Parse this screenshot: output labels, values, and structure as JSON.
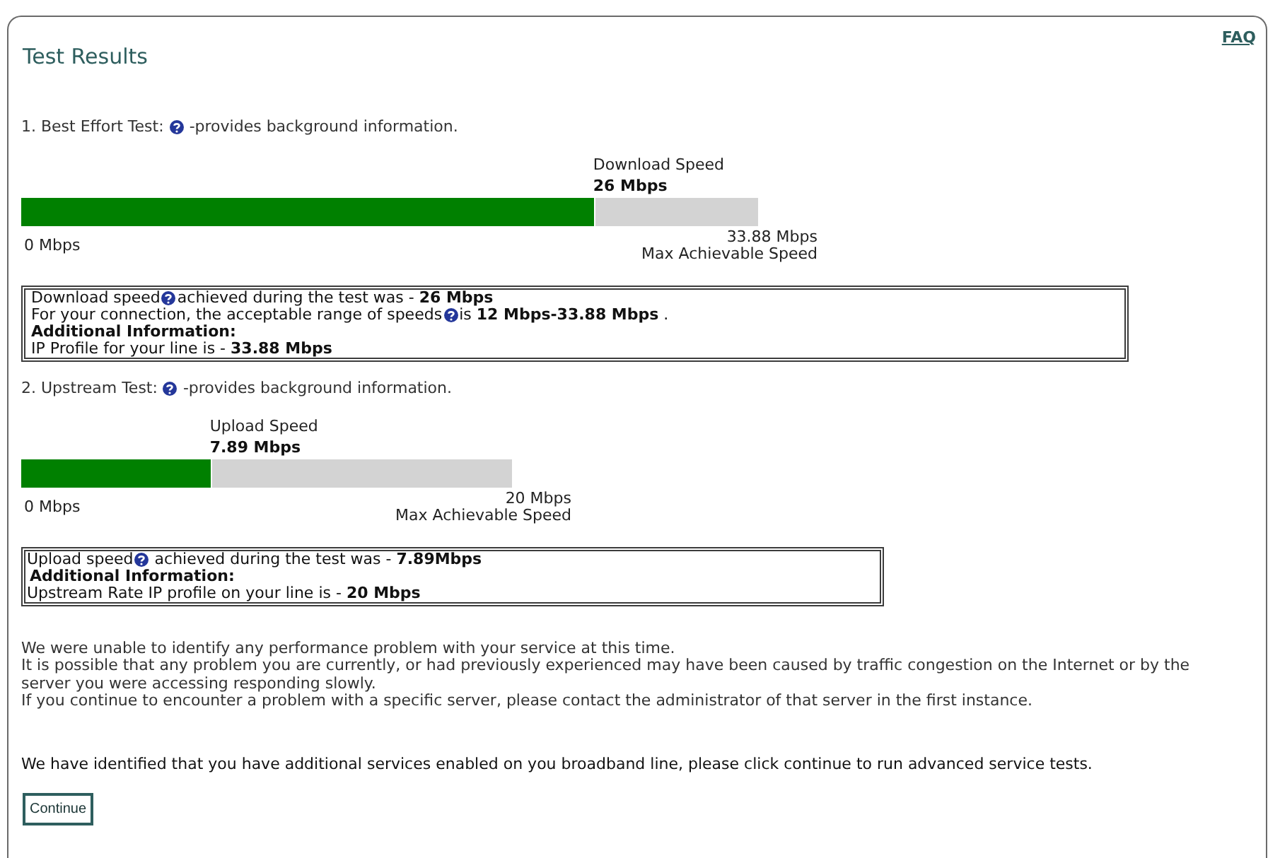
{
  "header": {
    "title": "Test Results",
    "faq_link": "FAQ"
  },
  "tests": [
    {
      "heading": "1. Best Effort Test:",
      "help": true,
      "note": "-provides background information.",
      "meter": {
        "label": "Download Speed",
        "reading": "26 Mbps",
        "level": 0.78,
        "min_label": "0 Mbps",
        "max_reading": "33.88 Mbps",
        "max_label": "Max Achievable Speed"
      },
      "summary": [
        {
          "kind": "text",
          "text": "Download speed",
          "help": true,
          "after": "achieved during the test was - **26 Mbps**"
        },
        {
          "kind": "text",
          "text": "For your connection, the acceptable range of speeds",
          "help": true,
          "after": "is **12 Mbps-33.88 Mbps** ."
        },
        {
          "kind": "heading",
          "text": "Additional Information:"
        },
        {
          "kind": "text",
          "text": "IP Profile for your line is - **33.88 Mbps**"
        }
      ]
    },
    {
      "heading": "2. Upstream Test:",
      "help": true,
      "note": "-provides background information.",
      "meter": {
        "label": "Upload Speed",
        "reading": "7.89 Mbps",
        "level": 0.39,
        "min_label": "0 Mbps",
        "max_reading": "20 Mbps",
        "max_label": "Max Achievable Speed"
      },
      "summary": [
        {
          "kind": "text",
          "text": "Upload speed",
          "help": true,
          "after": "achieved during the test was - **7.89Mbps**"
        },
        {
          "kind": "heading",
          "text": "Additional Information:"
        },
        {
          "kind": "text",
          "text": "Upstream Rate IP profile on your line is - **20 Mbps**"
        }
      ]
    }
  ],
  "messages": [
    "We were unable to identify any performance problem with your service at this time.",
    "It is possible that any problem you are currently, or had previously experienced may have been caused by traffic congestion on the Internet or by the server you were accessing responding slowly.",
    "If you continue to encounter a problem with a specific server, please contact the administrator of that server in the first instance."
  ],
  "notice": "We have identified that you have additional services enabled on you broadband line, please click continue to run advanced service tests.",
  "continue_button": "Continue"
}
